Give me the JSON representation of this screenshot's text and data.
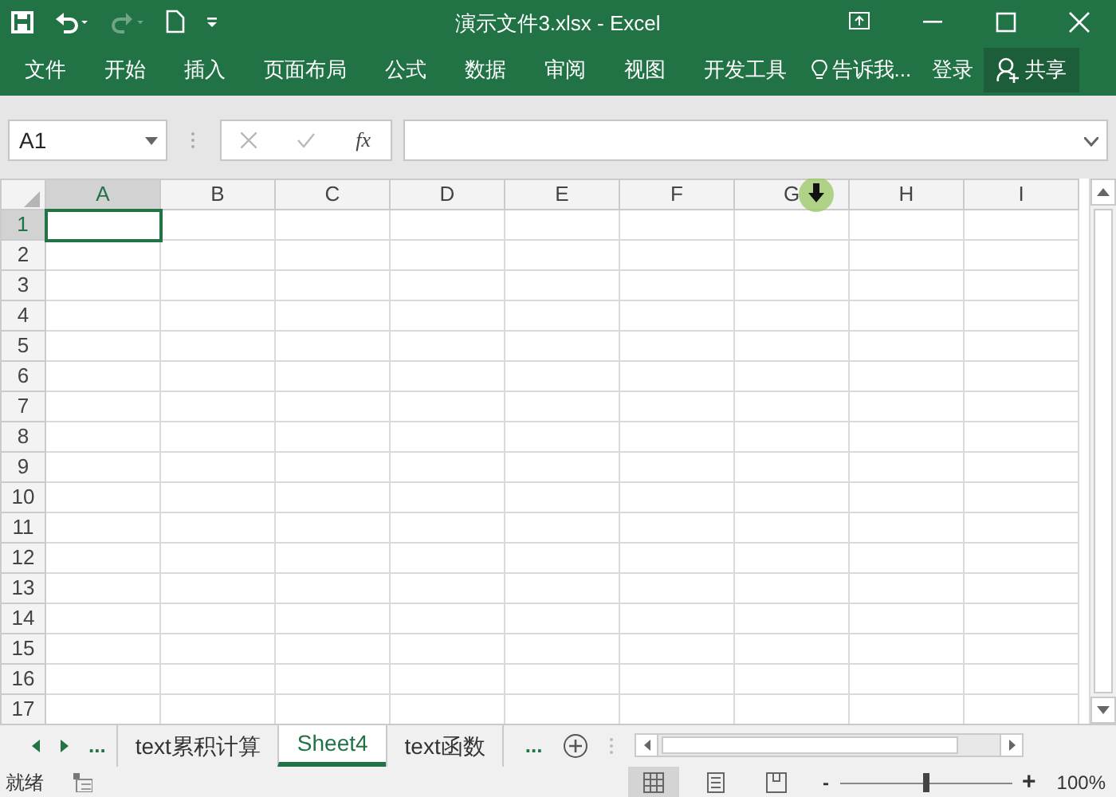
{
  "window": {
    "title": "演示文件3.xlsx - Excel"
  },
  "ribbon": {
    "tabs": [
      {
        "label": "文件"
      },
      {
        "label": "开始"
      },
      {
        "label": "插入"
      },
      {
        "label": "页面布局"
      },
      {
        "label": "公式"
      },
      {
        "label": "数据"
      },
      {
        "label": "审阅"
      },
      {
        "label": "视图"
      },
      {
        "label": "开发工具"
      }
    ],
    "tell_me": "告诉我...",
    "sign_in": "登录",
    "share": "共享"
  },
  "formula_bar": {
    "name_box": "A1",
    "function_label": "fx"
  },
  "grid": {
    "columns": [
      {
        "label": "A",
        "selected": true
      },
      {
        "label": "B",
        "selected": false
      },
      {
        "label": "C",
        "selected": false
      },
      {
        "label": "D",
        "selected": false
      },
      {
        "label": "E",
        "selected": false
      },
      {
        "label": "F",
        "selected": false
      },
      {
        "label": "G",
        "selected": false
      },
      {
        "label": "H",
        "selected": false
      },
      {
        "label": "I",
        "selected": false
      }
    ],
    "rows": [
      {
        "label": "1",
        "selected": true
      },
      {
        "label": "2",
        "selected": false
      },
      {
        "label": "3",
        "selected": false
      },
      {
        "label": "4",
        "selected": false
      },
      {
        "label": "5",
        "selected": false
      },
      {
        "label": "6",
        "selected": false
      },
      {
        "label": "7",
        "selected": false
      },
      {
        "label": "8",
        "selected": false
      },
      {
        "label": "9",
        "selected": false
      },
      {
        "label": "10",
        "selected": false
      },
      {
        "label": "11",
        "selected": false
      },
      {
        "label": "12",
        "selected": false
      },
      {
        "label": "13",
        "selected": false
      },
      {
        "label": "14",
        "selected": false
      },
      {
        "label": "15",
        "selected": false
      },
      {
        "label": "16",
        "selected": false
      },
      {
        "label": "17",
        "selected": false
      }
    ]
  },
  "sheet_bar": {
    "ellipsis_left": "...",
    "ellipsis_right": "...",
    "tabs": [
      {
        "label": "text累积计算",
        "selected": false
      },
      {
        "label": "Sheet4",
        "selected": true
      },
      {
        "label": "text函数",
        "selected": false
      }
    ]
  },
  "status_bar": {
    "status": "就绪",
    "views": [
      {
        "kind": "normal",
        "selected": true
      },
      {
        "kind": "page_layout",
        "selected": false
      },
      {
        "kind": "page_break",
        "selected": false
      }
    ],
    "zoom": {
      "minus": "-",
      "plus": "+",
      "level": 0.5,
      "reading": "100%"
    }
  }
}
